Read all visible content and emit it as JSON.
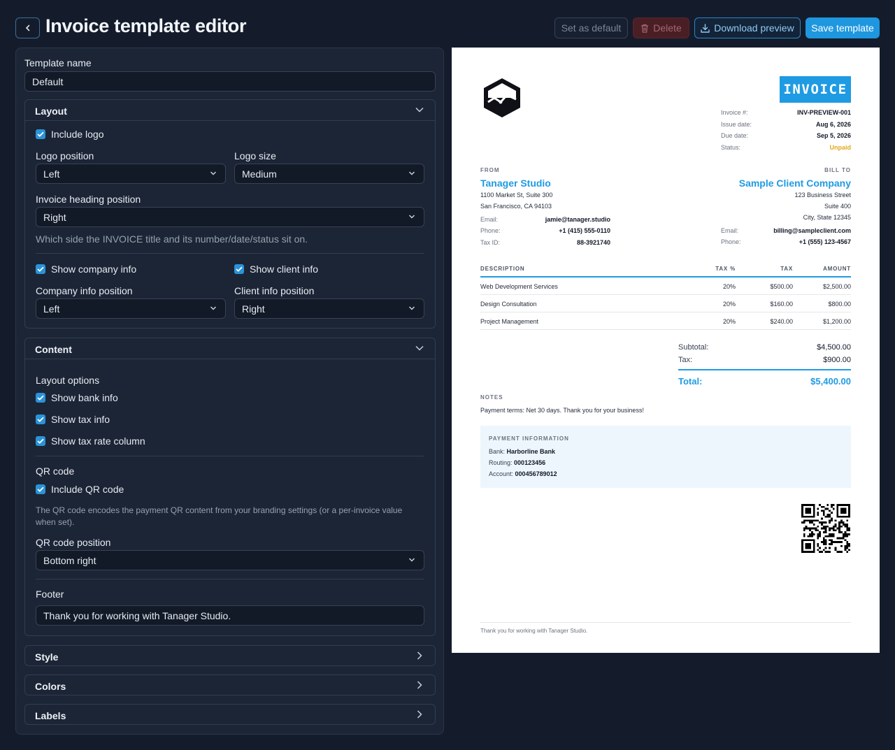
{
  "header": {
    "title": "Invoice template editor",
    "set_default_label": "Set as default",
    "delete_label": "Delete",
    "download_label": "Download preview",
    "save_label": "Save template"
  },
  "editor": {
    "template_name_label": "Template name",
    "template_name_value": "Default",
    "layout": {
      "title": "Layout",
      "include_logo": "Include logo",
      "logo_position_label": "Logo position",
      "logo_position_value": "Left",
      "logo_size_label": "Logo size",
      "logo_size_value": "Medium",
      "heading_position_label": "Invoice heading position",
      "heading_position_value": "Right",
      "heading_help": "Which side the INVOICE title and its number/date/status sit on.",
      "show_company_info": "Show company info",
      "show_client_info": "Show client info",
      "company_position_label": "Company info position",
      "company_position_value": "Left",
      "client_position_label": "Client info position",
      "client_position_value": "Right"
    },
    "content": {
      "title": "Content",
      "layout_options_label": "Layout options",
      "show_bank_info": "Show bank info",
      "show_tax_info": "Show tax info",
      "show_tax_rate_column": "Show tax rate column",
      "qr_label": "QR code",
      "include_qr": "Include QR code",
      "qr_help": "The QR code encodes the payment QR content from your branding settings (or a per-invoice value when set).",
      "qr_position_label": "QR code position",
      "qr_position_value": "Bottom right",
      "footer_label": "Footer",
      "footer_value": "Thank you for working with Tanager Studio."
    },
    "style_title": "Style",
    "colors_title": "Colors",
    "labels_title": "Labels"
  },
  "preview": {
    "heading": "INVOICE",
    "meta": [
      {
        "k": "Invoice #:",
        "v": "INV-PREVIEW-001"
      },
      {
        "k": "Issue date:",
        "v": "Aug 6, 2026"
      },
      {
        "k": "Due date:",
        "v": "Sep 5, 2026"
      },
      {
        "k": "Status:",
        "v": "Unpaid"
      }
    ],
    "from_caption": "FROM",
    "bill_caption": "BILL TO",
    "company": {
      "name": "Tanager Studio",
      "addr1": "1100 Market St, Suite 300",
      "addr2": "San Francisco, CA 94103",
      "email_k": "Email:",
      "email_v": "jamie@tanager.studio",
      "phone_k": "Phone:",
      "phone_v": "+1 (415) 555-0110",
      "tax_k": "Tax ID:",
      "tax_v": "88-3921740"
    },
    "client": {
      "name": "Sample Client Company",
      "addr1": "123 Business Street",
      "addr2": "Suite 400",
      "addr3": "City, State 12345",
      "email_k": "Email:",
      "email_v": "billing@sampleclient.com",
      "phone_k": "Phone:",
      "phone_v": "+1 (555) 123-4567"
    },
    "columns": {
      "description": "DESCRIPTION",
      "tax_pct": "TAX %",
      "tax": "TAX",
      "amount": "AMOUNT"
    },
    "items": [
      {
        "description": "Web Development Services",
        "tax_pct": "20%",
        "tax": "$500.00",
        "amount": "$2,500.00"
      },
      {
        "description": "Design Consultation",
        "tax_pct": "20%",
        "tax": "$160.00",
        "amount": "$800.00"
      },
      {
        "description": "Project Management",
        "tax_pct": "20%",
        "tax": "$240.00",
        "amount": "$1,200.00"
      }
    ],
    "subtotal_k": "Subtotal:",
    "subtotal_v": "$4,500.00",
    "tax_k": "Tax:",
    "tax_v": "$900.00",
    "total_k": "Total:",
    "total_v": "$5,400.00",
    "notes_caption": "NOTES",
    "notes_text": "Payment terms: Net 30 days. Thank you for your business!",
    "payment": {
      "caption": "PAYMENT INFORMATION",
      "bank_k": "Bank:",
      "bank_v": "Harborline Bank",
      "routing_k": "Routing:",
      "routing_v": "000123456",
      "account_k": "Account:",
      "account_v": "000456789012"
    },
    "footer": "Thank you for working with Tanager Studio."
  },
  "colors": {
    "accent": "#1e9be3",
    "status_unpaid": "#e0a91c",
    "page_bg": "#141c2c",
    "panel_bg": "#1c2536"
  }
}
